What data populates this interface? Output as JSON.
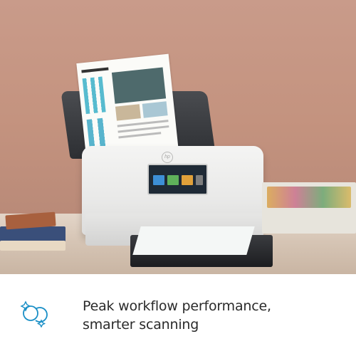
{
  "image": {
    "alt": "Document scanner on a desk with paper in the input tray and scanned pages in the output tray"
  },
  "scanner": {
    "logo_text": "hp"
  },
  "caption": {
    "icon": "workflow-cycle-sparkle-icon",
    "line1": "Peak workflow performance,",
    "line2": "smarter scanning",
    "accent_color": "#1a8fc6",
    "text_color": "#2a2a2a"
  }
}
